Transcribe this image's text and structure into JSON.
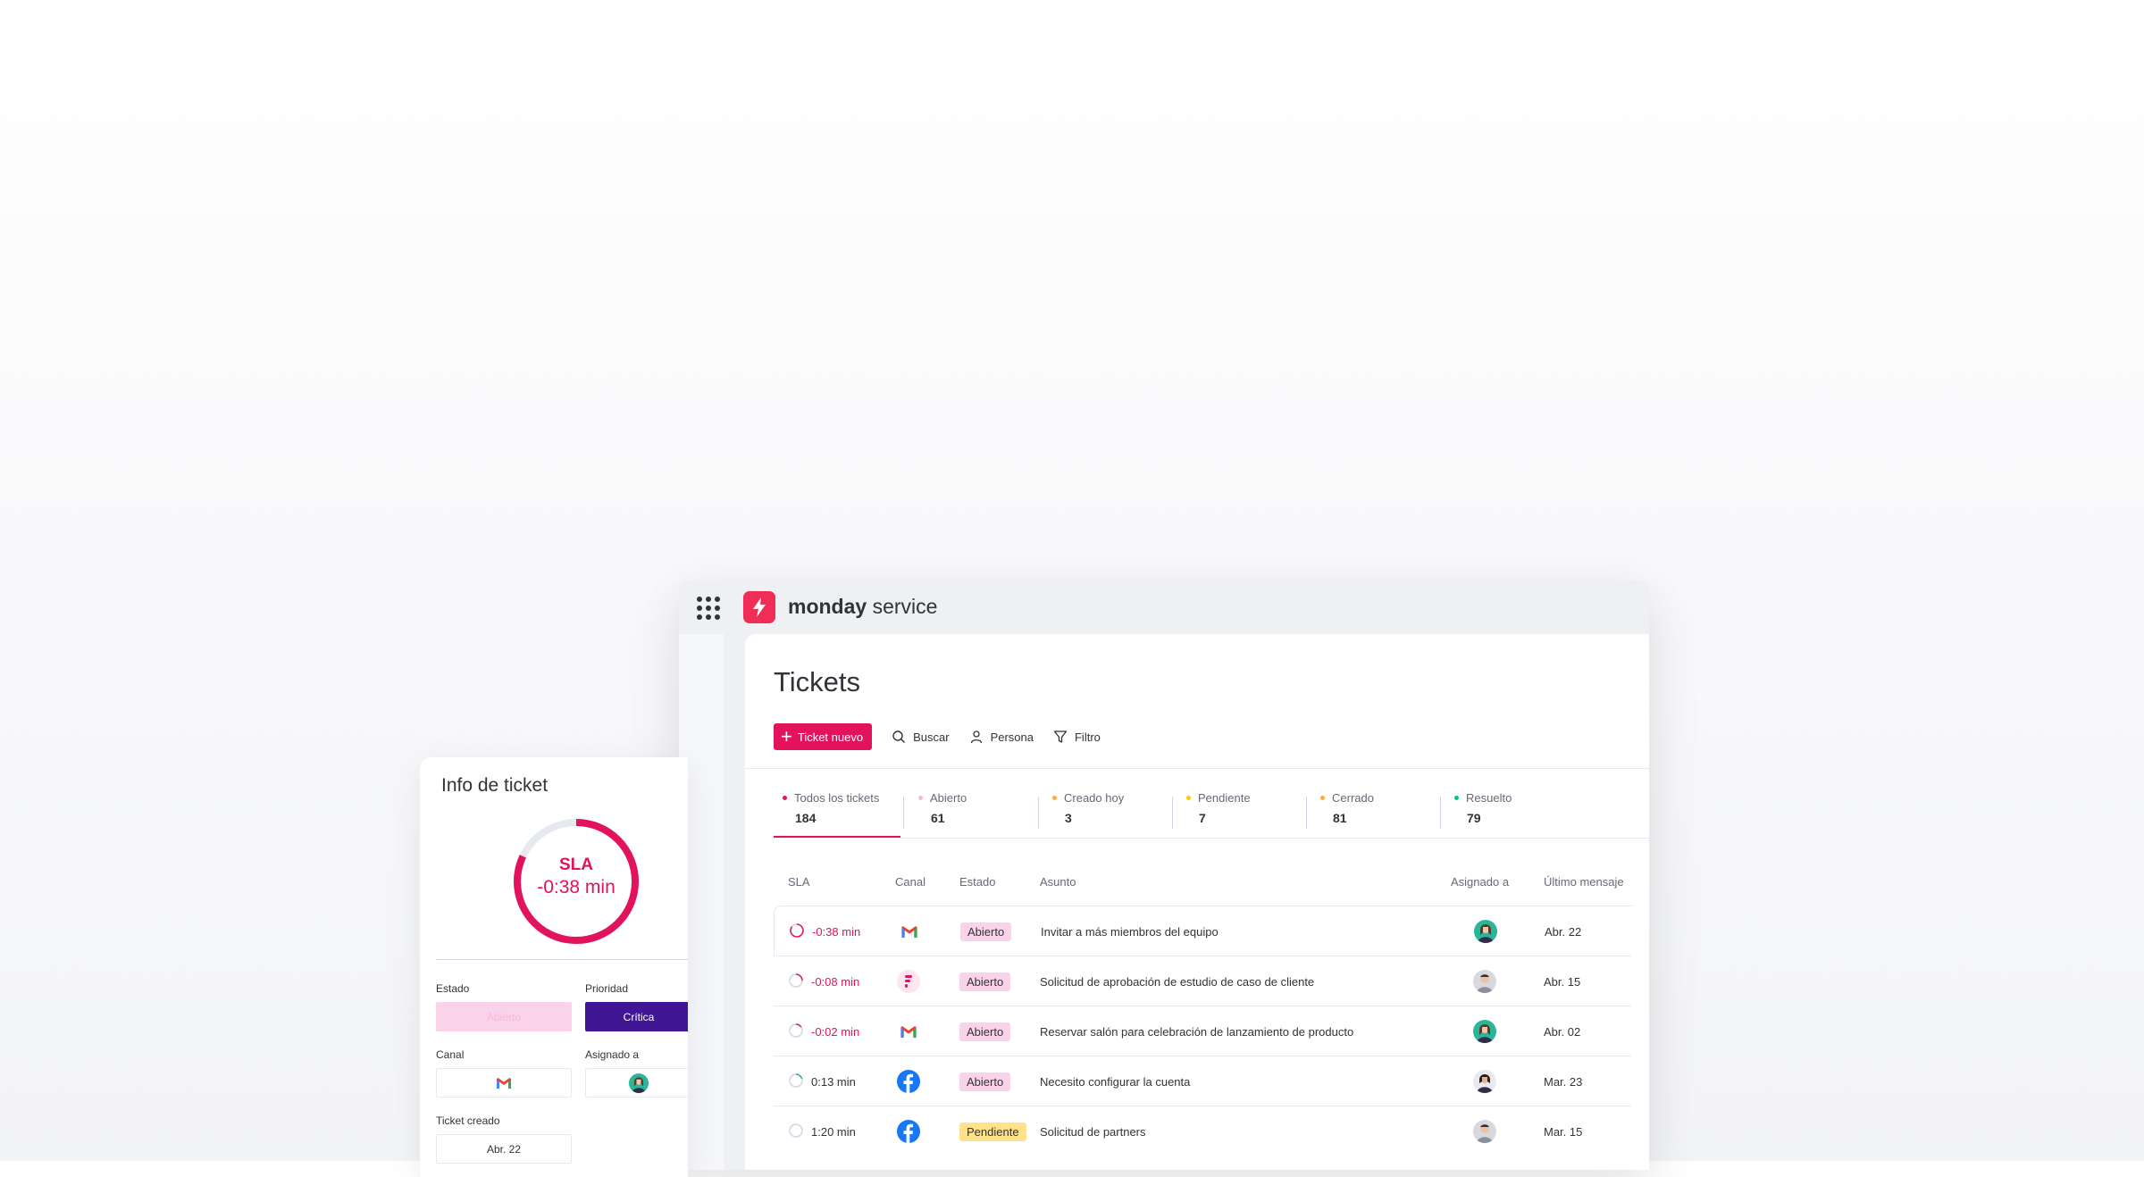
{
  "app": {
    "brand_bold": "monday",
    "brand_light": " service"
  },
  "page": {
    "title": "Tickets"
  },
  "toolbar": {
    "new_ticket": "Ticket nuevo",
    "search": "Buscar",
    "person": "Persona",
    "filter": "Filtro"
  },
  "tabs": [
    {
      "label": "Todos los tickets",
      "count": "184",
      "color": "#e2135c"
    },
    {
      "label": "Abierto",
      "count": "61",
      "color": "#f7b8de"
    },
    {
      "label": "Creado hoy",
      "count": "3",
      "color": "#fdab3d"
    },
    {
      "label": "Pendiente",
      "count": "7",
      "color": "#ffcb00"
    },
    {
      "label": "Cerrado",
      "count": "81",
      "color": "#fdab3d"
    },
    {
      "label": "Resuelto",
      "count": "79",
      "color": "#00c875"
    }
  ],
  "table": {
    "headers": {
      "sla": "SLA",
      "canal": "Canal",
      "estado": "Estado",
      "asunto": "Asunto",
      "asignado": "Asignado a",
      "ultimo": "Último mensaje"
    },
    "rows": [
      {
        "sla": "-0:38 min",
        "sla_negative": true,
        "sla_progress": 0.85,
        "channel_icon": "gmail-icon",
        "estado": "Abierto",
        "asunto": "Invitar a más miembros del equipo",
        "ultimo": "Abr. 22"
      },
      {
        "sla": "-0:08 min",
        "sla_negative": true,
        "sla_progress": 0.25,
        "channel_icon": "form-icon",
        "estado": "Abierto",
        "asunto": "Solicitud de aprobación de estudio de caso de cliente",
        "ultimo": "Abr. 15"
      },
      {
        "sla": "-0:02 min",
        "sla_negative": true,
        "sla_progress": 0.15,
        "channel_icon": "gmail-icon",
        "estado": "Abierto",
        "asunto": "Reservar salón para celebración de lanzamiento de producto",
        "ultimo": "Abr. 02"
      },
      {
        "sla": "0:13 min",
        "sla_negative": false,
        "sla_progress": 0.2,
        "channel_icon": "facebook-icon",
        "estado": "Abierto",
        "asunto": "Necesito configurar la cuenta",
        "ultimo": "Mar. 23"
      },
      {
        "sla": "1:20 min",
        "sla_negative": false,
        "sla_progress": 0.0,
        "channel_icon": "facebook-icon",
        "estado": "Pendiente",
        "asunto": "Solicitud de partners",
        "ultimo": "Mar. 15"
      }
    ]
  },
  "info_card": {
    "title": "Info de ticket",
    "sla_label": "SLA",
    "sla_value": "-0:38 min",
    "sla_progress": 0.82,
    "estado_label": "Estado",
    "estado_value": "Abierto",
    "prioridad_label": "Prioridad",
    "prioridad_value": "Crítica",
    "canal_label": "Canal",
    "asignado_label": "Asignado a",
    "creado_label": "Ticket creado",
    "creado_value": "Abr. 22"
  },
  "colors": {
    "accent": "#e2135c",
    "brand": "#ef2d56",
    "priority_critical": "#401694"
  }
}
